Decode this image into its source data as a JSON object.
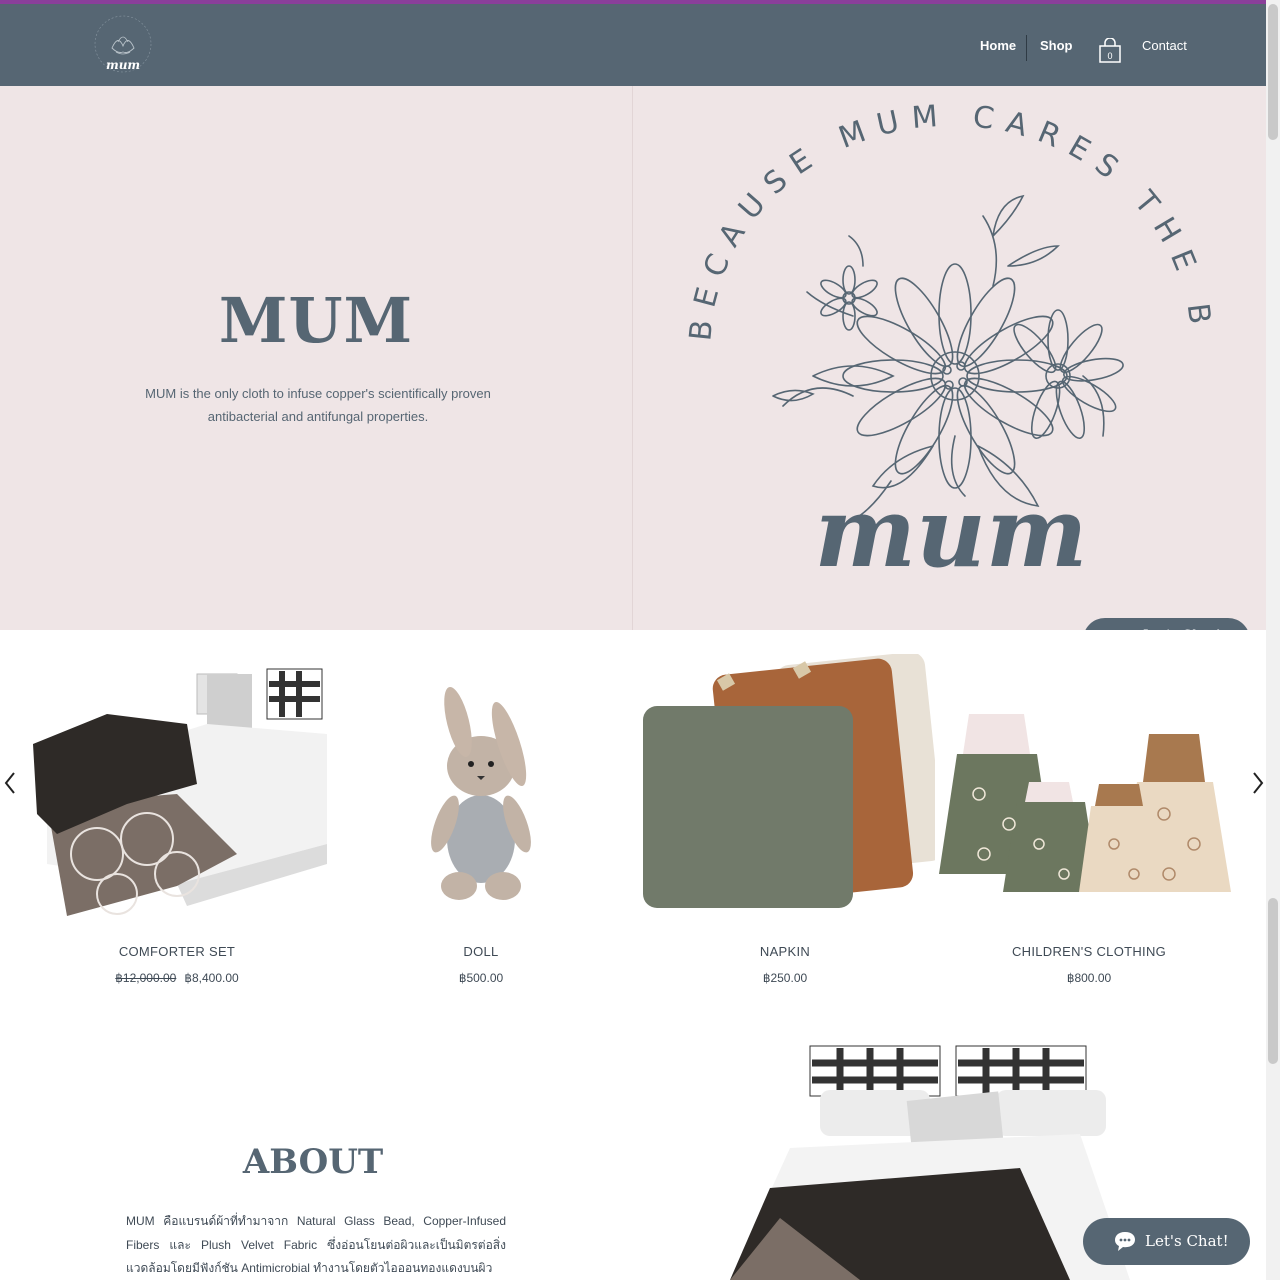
{
  "header": {
    "logo_text": "mum",
    "logo_ring_text": "BECAUSE MUM CARES THE BEST",
    "nav": {
      "home": "Home",
      "shop": "Shop",
      "contact": "Contact"
    },
    "cart_count": "0"
  },
  "hero": {
    "title": "MUM",
    "description": "MUM is the only cloth to infuse copper's scientifically proven antibacterial and antifungal properties.",
    "arc_text": "BECAUSE MUM CARES THE BEST",
    "script_word": "mum"
  },
  "products": [
    {
      "name": "COMFORTER SET",
      "old_price": "฿12,000.00",
      "price": "฿8,400.00"
    },
    {
      "name": "DOLL",
      "old_price": "",
      "price": "฿500.00"
    },
    {
      "name": "NAPKIN",
      "old_price": "",
      "price": "฿250.00"
    },
    {
      "name": "CHILDREN'S CLOTHING",
      "old_price": "",
      "price": "฿800.00"
    }
  ],
  "about": {
    "title": "ABOUT",
    "text": "MUM คือแบรนด์ผ้าที่ทำมาจาก Natural Glass Bead, Copper-Infused Fibers และ Plush Velvet Fabric ซึ่งอ่อนโยนต่อผิวและเป็นมิตรต่อสิ่งแวดล้อมโดยมีฟังก์ชัน Antimicrobial ทำงานโดยตัวไอออนทองแดงบนผิว"
  },
  "chat": {
    "label": "Let's Chat!"
  },
  "colors": {
    "header": "#566673",
    "hero_bg": "#efe5e6",
    "accent_strip": "#8a3f9a"
  }
}
